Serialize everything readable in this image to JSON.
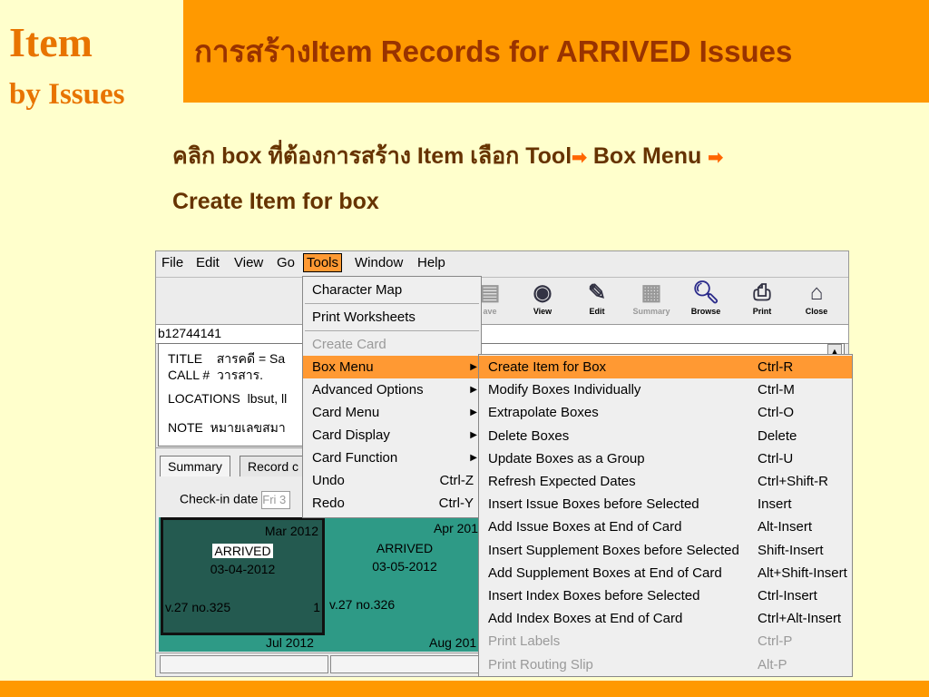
{
  "slide": {
    "side_title_line1": "Item",
    "side_title_line2": "by Issues",
    "main_title": "การสร้างItem Records for ARRIVED Issues",
    "instruction_line1_a": "คลิก box ที่ต้องการสร้าง Item  เลือก Tool",
    "instruction_line1_b": " Box Menu ",
    "instruction_line2": "Create Item for box",
    "arrow_glyph": "➡"
  },
  "app": {
    "menubar": [
      "File",
      "Edit",
      "View",
      "Go",
      "Tools",
      "Window",
      "Help"
    ],
    "toolbar": [
      {
        "label": "ave",
        "icon": "save-icon",
        "enabled": false
      },
      {
        "label": "View",
        "icon": "view-icon",
        "enabled": true
      },
      {
        "label": "Edit",
        "icon": "edit-icon",
        "enabled": true
      },
      {
        "label": "Summary",
        "icon": "summary-icon",
        "enabled": false
      },
      {
        "label": "Browse",
        "icon": "browse-icon",
        "enabled": true
      },
      {
        "label": "Print",
        "icon": "print-icon",
        "enabled": true
      },
      {
        "label": "Close",
        "icon": "close-icon",
        "enabled": true
      }
    ],
    "record_id": "b12744141",
    "info": {
      "title_label": "TITLE",
      "title_value": "สารคดี = Sa",
      "call_label": "CALL #",
      "call_value": "วารสาร.",
      "locations_label": "LOCATIONS",
      "locations_value": "lbsut, ll",
      "note_label": "NOTE",
      "note_value": "หมายเลขสมา"
    },
    "tabs": [
      "Summary",
      "Record c"
    ],
    "checkin_label": "Check-in date",
    "checkin_value": "Fri 3",
    "boxes": [
      {
        "month": "Mar 2012",
        "status": "ARRIVED",
        "date": "03-04-2012",
        "volume": "v.27 no.325",
        "extra": "1"
      },
      {
        "month": "Apr 201",
        "status": "ARRIVED",
        "date": "03-05-2012",
        "volume": "v.27 no.326",
        "extra": ""
      }
    ],
    "next_row": [
      "Jul 2012",
      "Aug 201"
    ]
  },
  "tools_menu": [
    {
      "label": "Character Map",
      "shortcut": "",
      "submenu": false,
      "enabled": true,
      "sep_after": true
    },
    {
      "label": "Print Worksheets",
      "shortcut": "",
      "submenu": false,
      "enabled": true,
      "sep_after": true
    },
    {
      "label": "Create Card",
      "shortcut": "",
      "submenu": false,
      "enabled": false,
      "sep_after": false
    },
    {
      "label": "Box Menu",
      "shortcut": "",
      "submenu": true,
      "enabled": true,
      "selected": true,
      "sep_after": false
    },
    {
      "label": "Advanced Options",
      "shortcut": "",
      "submenu": true,
      "enabled": true,
      "sep_after": false
    },
    {
      "label": "Card Menu",
      "shortcut": "",
      "submenu": true,
      "enabled": true,
      "sep_after": false
    },
    {
      "label": "Card Display",
      "shortcut": "",
      "submenu": true,
      "enabled": true,
      "sep_after": false
    },
    {
      "label": "Card Function",
      "shortcut": "",
      "submenu": true,
      "enabled": true,
      "sep_after": false
    },
    {
      "label": "Undo",
      "shortcut": "Ctrl-Z",
      "submenu": false,
      "enabled": true,
      "sep_after": false
    },
    {
      "label": "Redo",
      "shortcut": "Ctrl-Y",
      "submenu": false,
      "enabled": true,
      "sep_after": false
    }
  ],
  "box_menu": [
    {
      "label": "Create Item for Box",
      "shortcut": "Ctrl-R",
      "enabled": true,
      "selected": true
    },
    {
      "label": "Modify Boxes Individually",
      "shortcut": "Ctrl-M",
      "enabled": true
    },
    {
      "label": "Extrapolate Boxes",
      "shortcut": "Ctrl-O",
      "enabled": true
    },
    {
      "label": "Delete Boxes",
      "shortcut": "Delete",
      "enabled": true
    },
    {
      "label": "Update Boxes as a Group",
      "shortcut": "Ctrl-U",
      "enabled": true
    },
    {
      "label": "Refresh Expected Dates",
      "shortcut": "Ctrl+Shift-R",
      "enabled": true
    },
    {
      "label": "Insert Issue Boxes before Selected",
      "shortcut": "Insert",
      "enabled": true
    },
    {
      "label": "Add Issue Boxes at End of Card",
      "shortcut": "Alt-Insert",
      "enabled": true
    },
    {
      "label": "Insert Supplement Boxes before Selected",
      "shortcut": "Shift-Insert",
      "enabled": true
    },
    {
      "label": "Add Supplement Boxes at End of Card",
      "shortcut": "Alt+Shift-Insert",
      "enabled": true
    },
    {
      "label": "Insert Index Boxes before Selected",
      "shortcut": "Ctrl-Insert",
      "enabled": true
    },
    {
      "label": "Add Index Boxes at End of Card",
      "shortcut": "Ctrl+Alt-Insert",
      "enabled": true
    },
    {
      "label": "Print Labels",
      "shortcut": "Ctrl-P",
      "enabled": false
    },
    {
      "label": "Print Routing Slip",
      "shortcut": "Alt-P",
      "enabled": false
    }
  ]
}
